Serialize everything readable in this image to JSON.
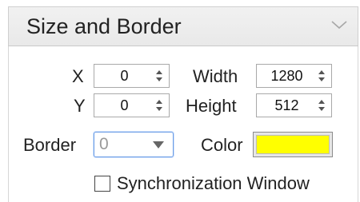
{
  "panel": {
    "title": "Size and Border",
    "collapse_icon": "chevron-down-icon"
  },
  "position": {
    "x_label": "X",
    "x_value": "0",
    "y_label": "Y",
    "y_value": "0"
  },
  "size": {
    "width_label": "Width",
    "width_value": "1280",
    "height_label": "Height",
    "height_value": "512"
  },
  "border": {
    "label": "Border",
    "value": "0",
    "dropdown_icon": "triangle-down-icon"
  },
  "color": {
    "label": "Color",
    "value": "#ffff00"
  },
  "sync": {
    "label": "Synchronization Window",
    "checked": false
  },
  "colors": {
    "focus_border": "#6c9ee6",
    "header_bg": "#eeeeee",
    "swatch": "#ffff00"
  }
}
